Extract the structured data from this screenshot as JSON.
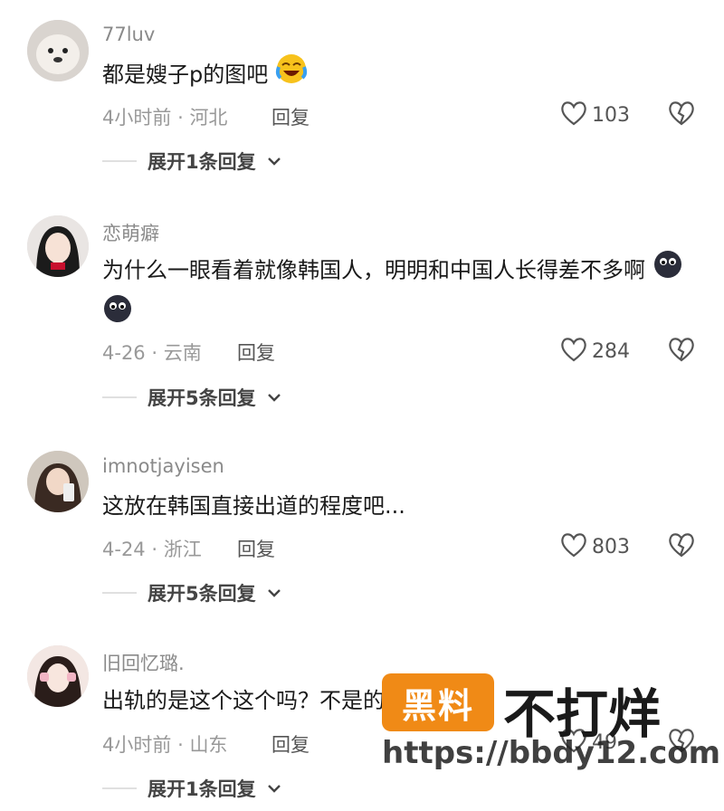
{
  "comments": [
    {
      "username": "77luv",
      "text": "都是嫂子p的图吧",
      "emoji": "crying-laughing-face",
      "time": "4小时前",
      "separator": "·",
      "location": "河北",
      "reply_label": "回复",
      "likes": "103",
      "expand_label": "展开1条回复"
    },
    {
      "username": "恋萌癖",
      "text": "为什么一眼看着就像韩国人，明明和中国人长得差不多啊",
      "emoji": "eyes-face",
      "time": "4-26",
      "separator": "·",
      "location": "云南",
      "reply_label": "回复",
      "likes": "284",
      "expand_label": "展开5条回复"
    },
    {
      "username": "imnotjayisen",
      "text": "这放在韩国直接出道的程度吧...",
      "time": "4-24",
      "separator": "·",
      "location": "浙江",
      "reply_label": "回复",
      "likes": "803",
      "expand_label": "展开5条回复"
    },
    {
      "username": "旧回忆璐.",
      "text": "出轨的是这个这个吗？不是的话就拉黑了",
      "time": "4小时前",
      "separator": "·",
      "location": "山东",
      "reply_label": "回复",
      "likes": "49",
      "expand_label": "展开1条回复"
    }
  ],
  "watermark": {
    "badge": "黑料",
    "title": "不打烊",
    "url": "https://bbdy12.com"
  },
  "colors": {
    "watermark_orange": "#f08a16",
    "text": "#1a1a1a",
    "meta": "#999999"
  }
}
